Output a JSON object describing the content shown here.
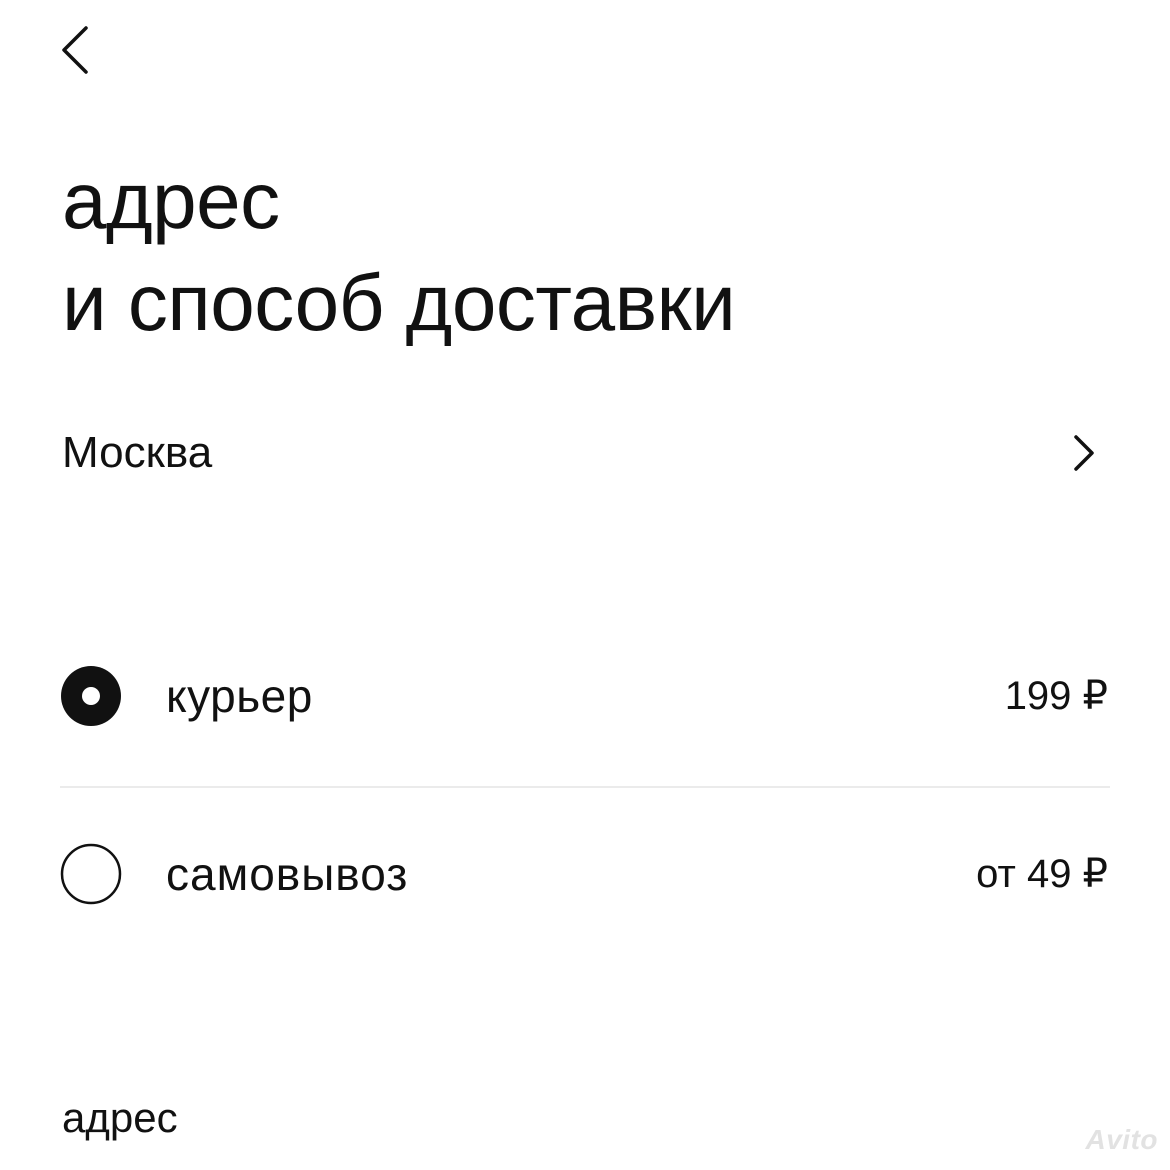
{
  "header": {
    "title_line1": "адрес",
    "title_line2": "и способ доставки"
  },
  "city": {
    "name": "Москва"
  },
  "delivery_options": [
    {
      "label": "курьер",
      "price": "199 ₽",
      "selected": true
    },
    {
      "label": "самовывоз",
      "price": "от 49 ₽",
      "selected": false
    }
  ],
  "address_section": {
    "label": "адрес"
  },
  "watermark": "Avito",
  "icons": {
    "back": "chevron-left-icon",
    "city_arrow": "chevron-right-icon",
    "radio_selected": "radio-selected-icon",
    "radio_unselected": "radio-unselected-icon"
  },
  "colors": {
    "text": "#111111",
    "divider": "#ebebeb",
    "background": "#ffffff",
    "watermark": "#e2e2e2"
  }
}
